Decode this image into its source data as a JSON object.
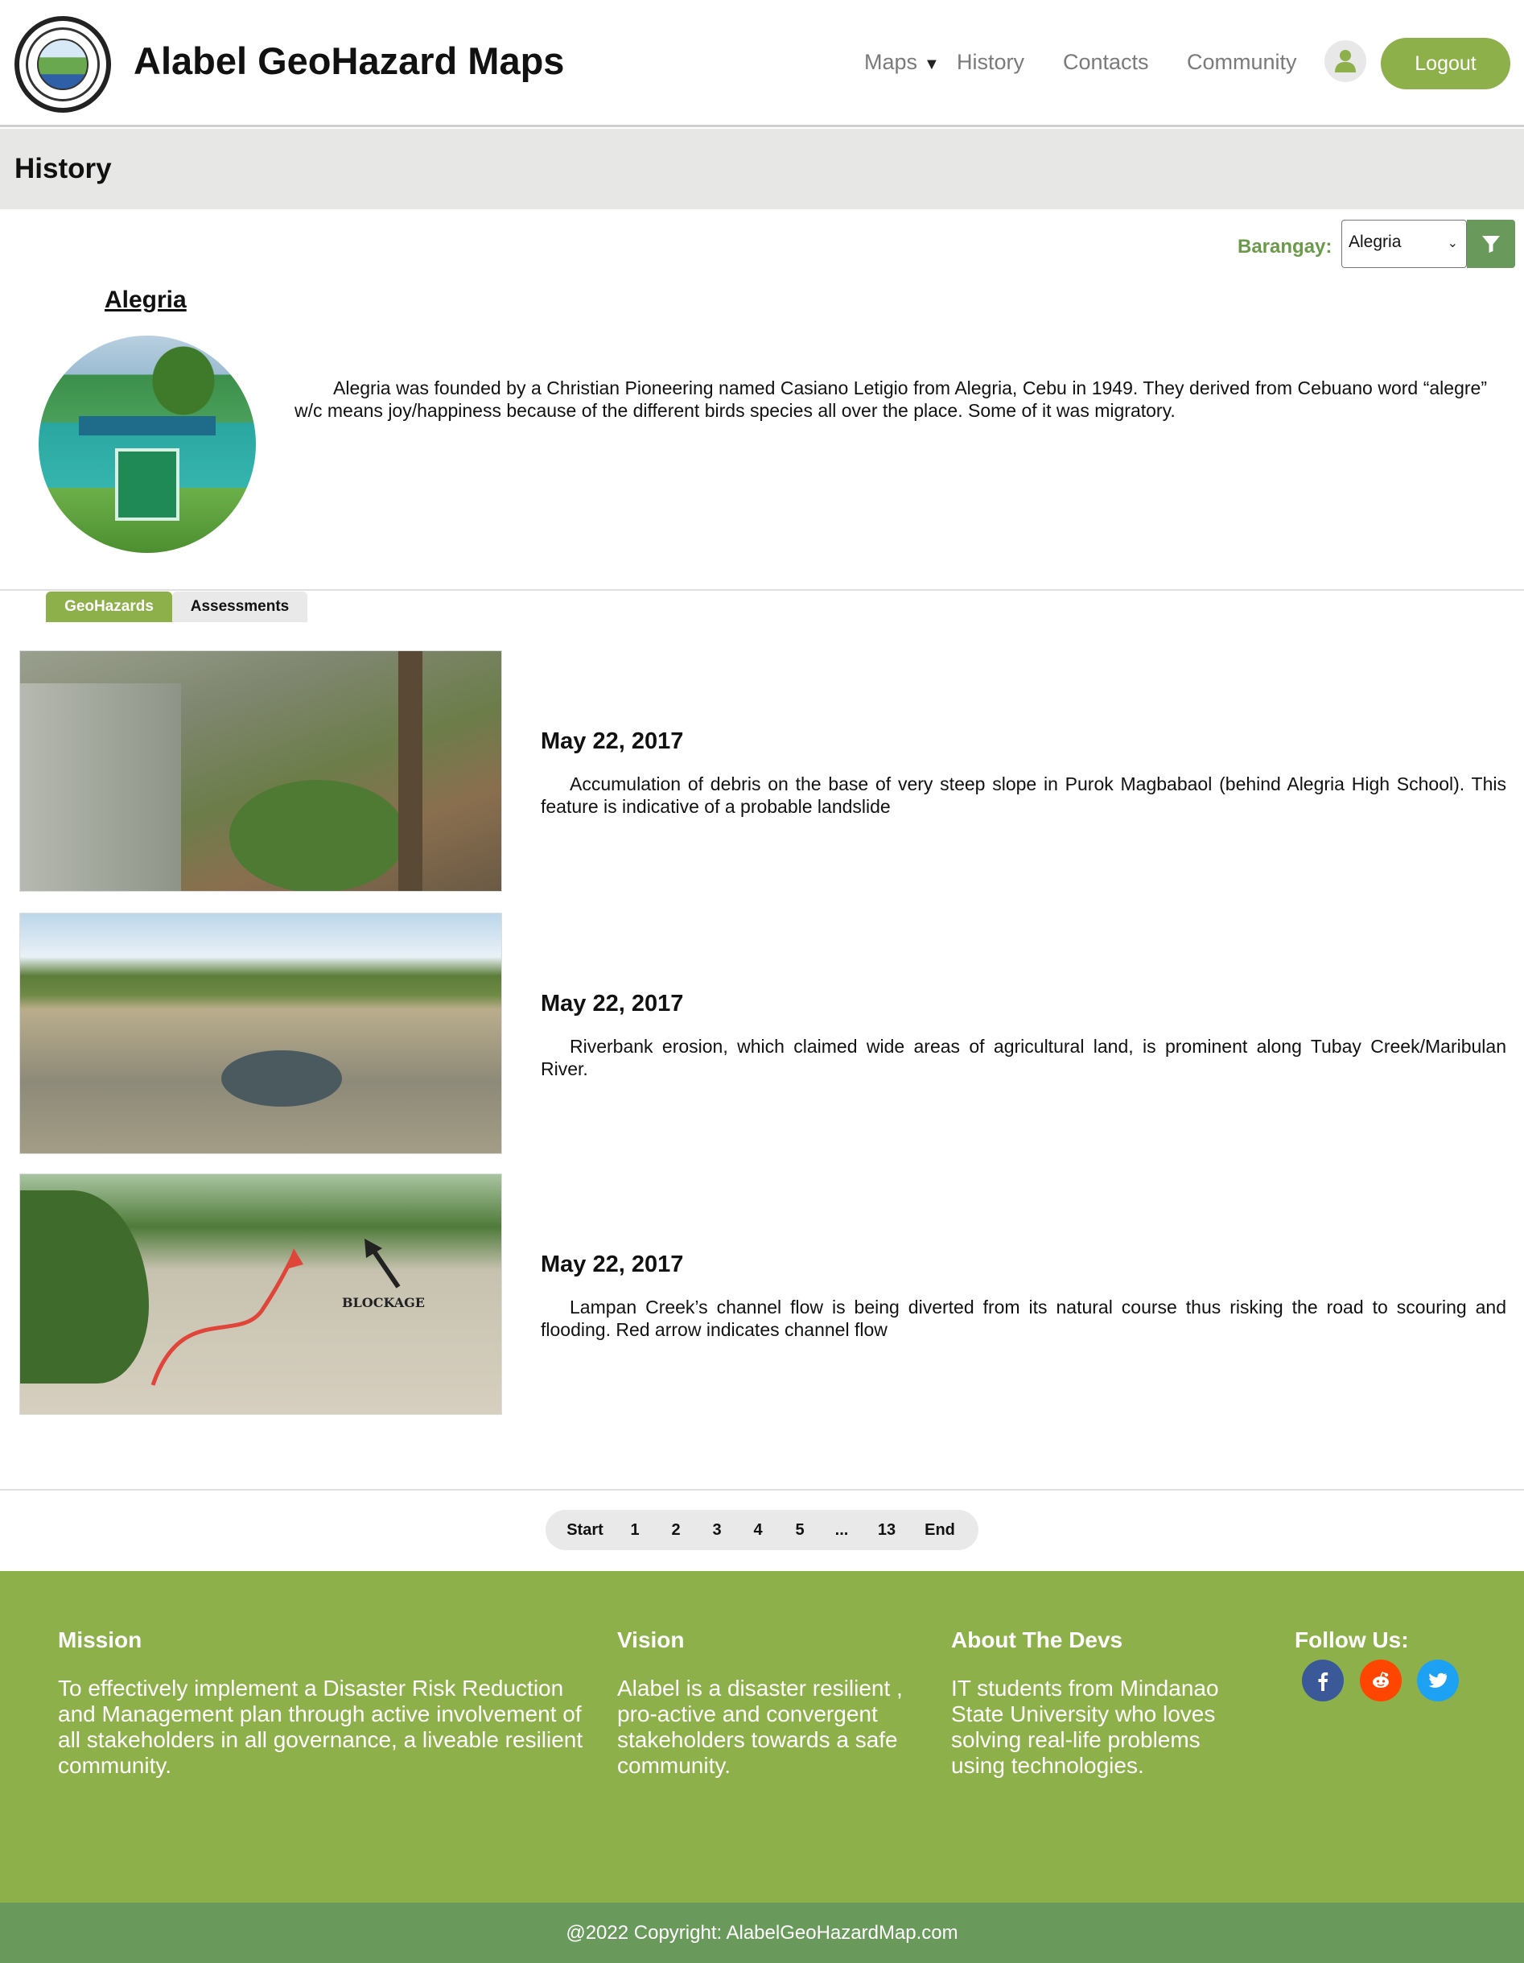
{
  "header": {
    "app_title": "Alabel GeoHazard Maps",
    "nav": {
      "maps": "Maps",
      "history": "History",
      "contacts": "Contacts",
      "community": "Community"
    },
    "logout": "Logout",
    "user_icon": "user-icon",
    "accent_color": "#8db04a"
  },
  "page": {
    "title": "History"
  },
  "filter": {
    "label": "Barangay:",
    "selected": "Alegria",
    "button_icon": "filter-icon"
  },
  "barangay": {
    "name": "Alegria",
    "description": "Alegria was founded by a Christian Pioneering named Casiano Letigio from Alegria, Cebu in 1949. They derived from Cebuano word “alegre” w/c means joy/happiness because of the different birds species all over the place. Some of it was migratory."
  },
  "tabs": {
    "geohazards": "GeoHazards",
    "assessments": "Assessments"
  },
  "entries": [
    {
      "date": "May 22, 2017",
      "text": "Accumulation of debris on the base of very steep slope in Purok Magbabaol (behind Alegria High School). This feature is indicative of a probable landslide"
    },
    {
      "date": "May 22, 2017",
      "text": "Riverbank erosion, which claimed wide areas of agricultural land, is prominent along Tubay Creek/Maribulan River."
    },
    {
      "date": "May 22, 2017",
      "text": "Lampan Creek’s channel flow is being diverted from its natural course thus risking the road to scouring and flooding. Red arrow indicates channel flow",
      "image_label": "BLOCKAGE"
    }
  ],
  "pagination": {
    "start": "Start",
    "pages": [
      "1",
      "2",
      "3",
      "4",
      "5",
      "...",
      "13"
    ],
    "end": "End"
  },
  "footer": {
    "mission": {
      "title": "Mission",
      "text": "To effectively implement a Disaster Risk Reduction and Management plan through active involvement of all stakeholders in all governance, a liveable resilient community."
    },
    "vision": {
      "title": "Vision",
      "text": "Alabel is a disaster resilient , pro-active and convergent stakeholders towards a safe community."
    },
    "about": {
      "title": "About The Devs",
      "text": "IT students from Mindanao State University who loves solving real-life problems using technologies."
    },
    "follow": {
      "title": "Follow Us:",
      "icons": [
        "facebook-icon",
        "reddit-icon",
        "twitter-icon"
      ]
    },
    "copyright": "@2022 Copyright: AlabelGeoHazardMap.com",
    "colors": {
      "footer": "#8db04a",
      "copyright_bar": "#6a9a5b"
    }
  }
}
